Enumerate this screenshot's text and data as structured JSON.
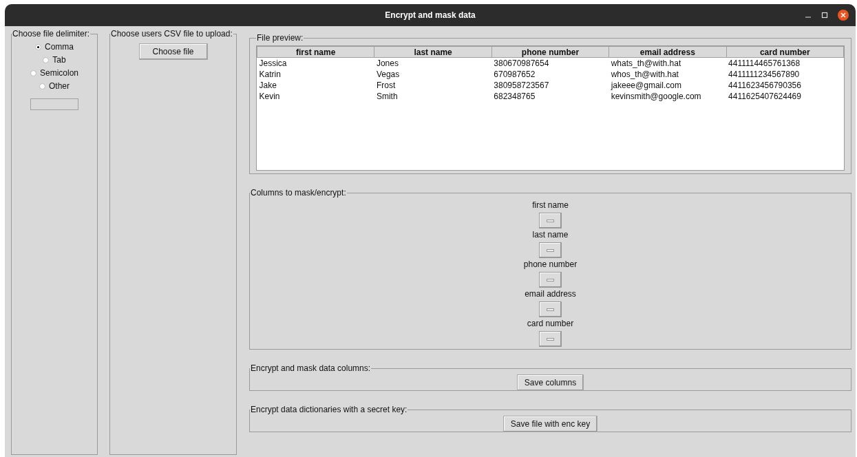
{
  "window": {
    "title": "Encrypt and mask data"
  },
  "delimiter": {
    "title": "Choose file delimiter:",
    "options": [
      {
        "label": "Comma",
        "selected": true
      },
      {
        "label": "Tab",
        "selected": false
      },
      {
        "label": "Semicolon",
        "selected": false
      },
      {
        "label": "Other",
        "selected": false
      }
    ]
  },
  "upload": {
    "title": "Choose users CSV file to upload:",
    "button": "Choose file"
  },
  "preview": {
    "title": "File preview:",
    "columns": [
      "first name",
      "last name",
      "phone number",
      "email address",
      "card number"
    ],
    "rows": [
      [
        "Jessica",
        "Jones",
        "380670987654",
        "whats_th@with.hat",
        "4411114465761368"
      ],
      [
        "Katrin",
        "Vegas",
        "670987652",
        "whos_th@with.hat",
        "4411111234567890"
      ],
      [
        "Jake",
        "Frost",
        "380958723567",
        "jakeee@gmail.com",
        "4411623456790356"
      ],
      [
        "Kevin",
        "Smith",
        "682348765",
        "kevinsmith@google.com",
        "4411625407624469"
      ]
    ]
  },
  "mask_columns": {
    "title": "Columns to mask/encrypt:",
    "items": [
      {
        "label": "first name",
        "checked": false
      },
      {
        "label": "last name",
        "checked": false
      },
      {
        "label": "phone number",
        "checked": false
      },
      {
        "label": "email address",
        "checked": false
      },
      {
        "label": "card number",
        "checked": false
      }
    ]
  },
  "save_columns": {
    "title": "Encrypt and mask data columns:",
    "button": "Save columns"
  },
  "save_key": {
    "title": "Encrypt data dictionaries with a secret key:",
    "button": "Save file with enc key"
  }
}
